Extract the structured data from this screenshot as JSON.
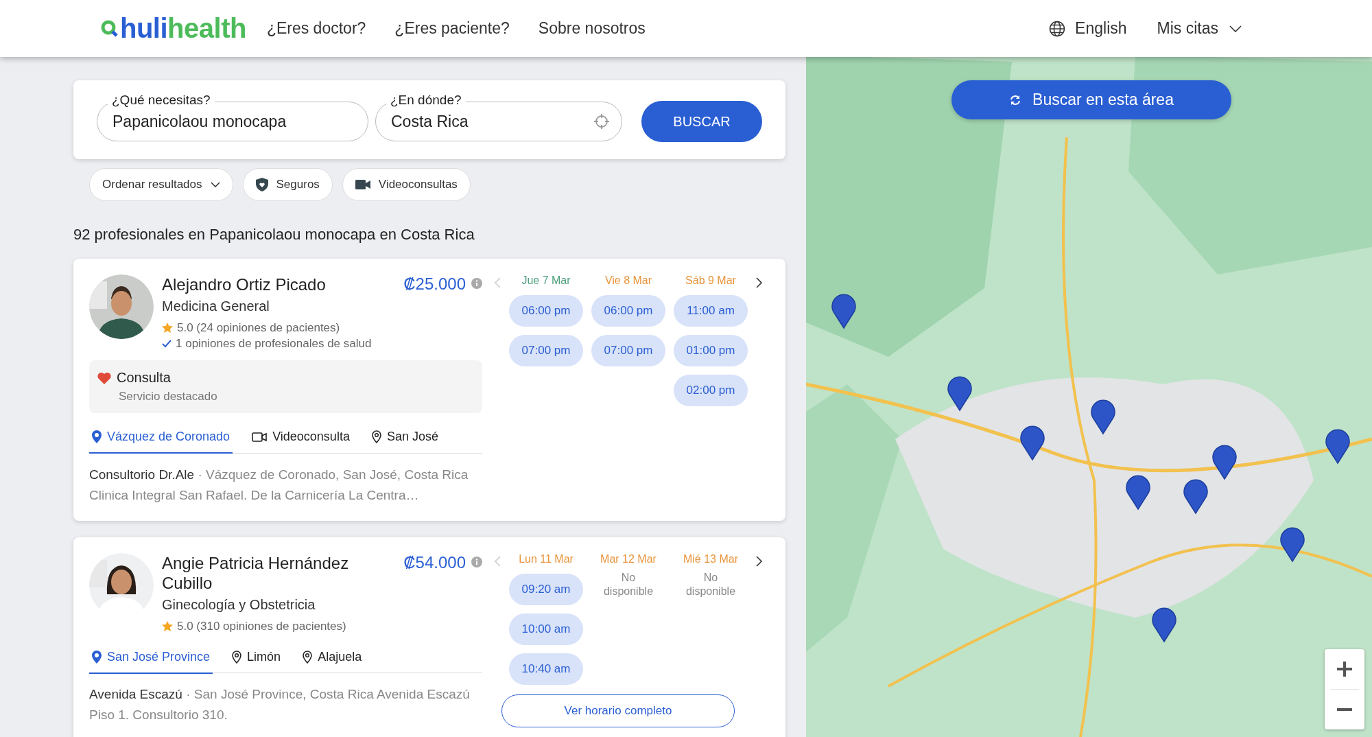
{
  "header": {
    "logo": {
      "first": "huli",
      "second": "health"
    },
    "nav": [
      "¿Eres doctor?",
      "¿Eres paciente?",
      "Sobre nosotros"
    ],
    "language": "English",
    "account_menu": "Mis citas"
  },
  "search": {
    "what": {
      "label": "¿Qué necesitas?",
      "value": "Papanicolaou monocapa"
    },
    "where": {
      "label": "¿En dónde?",
      "value": "Costa Rica"
    },
    "button": "BUSCAR"
  },
  "filters": [
    {
      "label": "Ordenar resultados",
      "kind": "dropdown"
    },
    {
      "label": "Seguros",
      "kind": "insurance"
    },
    {
      "label": "Videoconsultas",
      "kind": "video"
    }
  ],
  "results_summary": "92 profesionales en Papanicolaou monocapa en Costa Rica",
  "doctors": [
    {
      "name": "Alejandro Ortiz Picado",
      "specialty": "Medicina General",
      "price": "₡25.000",
      "rating": "5.0 (24 opiniones de pacientes)",
      "peer_reviews": "1 opiniones de profesionales de salud",
      "featured": {
        "title": "Consulta",
        "subtitle": "Servicio destacado"
      },
      "locations": [
        {
          "label": "Vázquez de Coronado",
          "kind": "place",
          "selected": true
        },
        {
          "label": "Videoconsulta",
          "kind": "video",
          "selected": false
        },
        {
          "label": "San José",
          "kind": "place",
          "selected": false
        }
      ],
      "clinic": "Consultorio Dr.Ale",
      "address": "· Vázquez de Coronado, San José, Costa Rica Clinica Integral San Rafael. De la Carnicería La Centra…",
      "schedule": {
        "prev_disabled": true,
        "days": [
          {
            "label": "Jue 7 Mar",
            "color": "#4c9f7d",
            "kind": "slots",
            "slots": [
              "06:00 pm",
              "07:00 pm"
            ]
          },
          {
            "label": "Vie 8 Mar",
            "color": "#e8943a",
            "kind": "slots",
            "slots": [
              "06:00 pm",
              "07:00 pm"
            ]
          },
          {
            "label": "Sáb 9 Mar",
            "color": "#e8943a",
            "kind": "slots",
            "slots": [
              "11:00 am",
              "01:00 pm",
              "02:00 pm"
            ]
          }
        ]
      }
    },
    {
      "name": "Angie Patricia Hernández Cubillo",
      "specialty": "Ginecología y Obstetricia",
      "price": "₡54.000",
      "rating": "5.0 (310 opiniones de pacientes)",
      "locations": [
        {
          "label": "San José Province",
          "kind": "place",
          "selected": true
        },
        {
          "label": "Limón",
          "kind": "place",
          "selected": false
        },
        {
          "label": "Alajuela",
          "kind": "place",
          "selected": false
        }
      ],
      "clinic": "Avenida Escazú",
      "address": "· San José Province, Costa Rica Avenida Escazú Piso 1. Consultorio 310.",
      "schedule": {
        "prev_disabled": true,
        "days": [
          {
            "label": "Lun 11 Mar",
            "color": "#e8943a",
            "kind": "slots",
            "slots": [
              "09:20 am",
              "10:00 am",
              "10:40 am"
            ]
          },
          {
            "label": "Mar 12 Mar",
            "color": "#e8943a",
            "kind": "unavailable",
            "note": "No disponible"
          },
          {
            "label": "Mié 13 Mar",
            "color": "#e8943a",
            "kind": "unavailable",
            "note": "No disponible"
          }
        ],
        "full_button": "Ver horario completo"
      }
    }
  ],
  "map": {
    "search_area_button": "Buscar en esta área"
  }
}
